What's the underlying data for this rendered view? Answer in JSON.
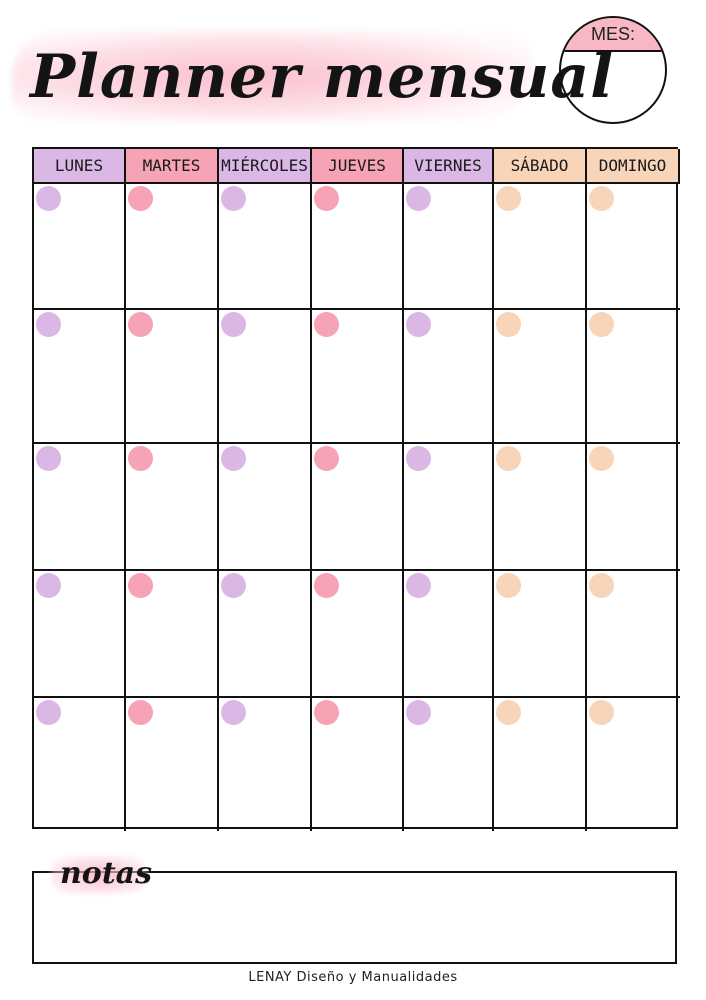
{
  "title": "Planner mensual",
  "month_box": {
    "label": "MES:",
    "value": ""
  },
  "days": [
    {
      "label": "LUNES",
      "color": "#dbb7e6"
    },
    {
      "label": "MARTES",
      "color": "#f5a3b5"
    },
    {
      "label": "MIÉRCOLES",
      "color": "#dbb7e6"
    },
    {
      "label": "JUEVES",
      "color": "#f5a3b5"
    },
    {
      "label": "VIERNES",
      "color": "#dbb7e6"
    },
    {
      "label": "SÁBADO",
      "color": "#f8d4b8"
    },
    {
      "label": "DOMINGO",
      "color": "#f8d4b8"
    }
  ],
  "weeks": 5,
  "notes": {
    "label": "notas",
    "value": ""
  },
  "footer": "LENAY Diseño y Manualidades",
  "colors": {
    "lilac": "#dbb7e6",
    "pink": "#f5a3b5",
    "peach": "#f8d4b8",
    "title_highlight": "#f8aabe",
    "line": "#111111"
  }
}
